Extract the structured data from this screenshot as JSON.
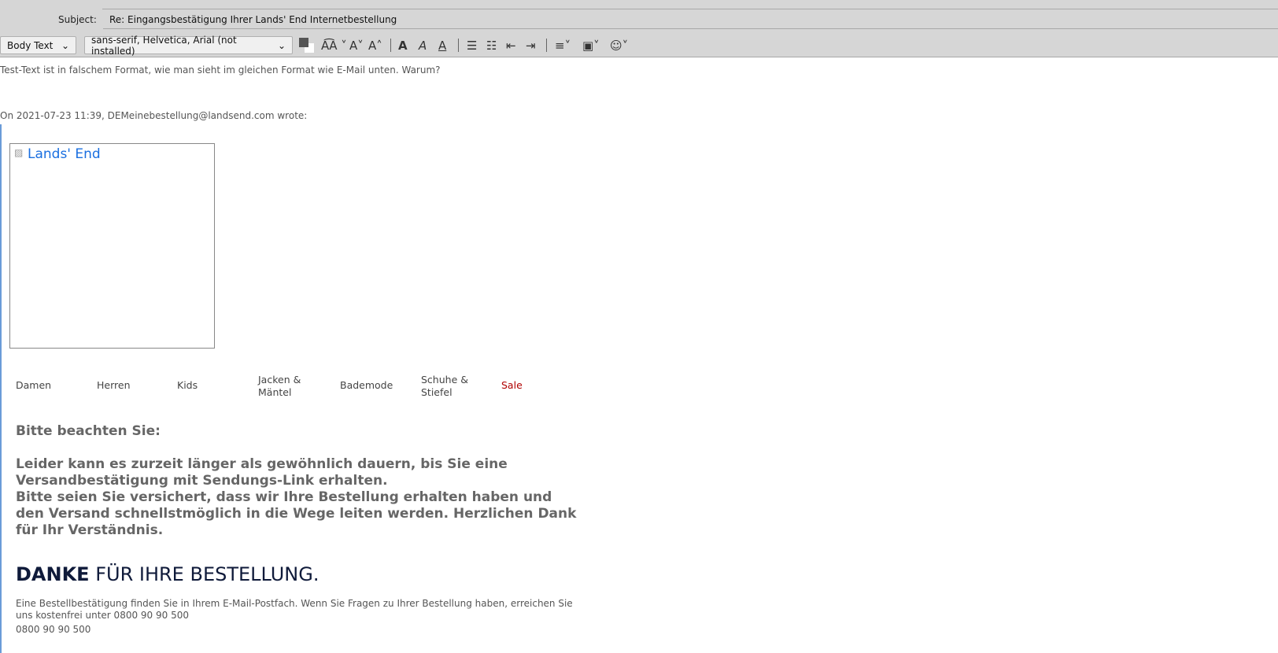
{
  "compose": {
    "subject_label": "Subject:",
    "subject_value": "Re: Eingangsbestätigung Ihrer Lands' End Internetbestellung"
  },
  "toolbar": {
    "paragraph_format": "Body Text",
    "font": "sans-serif, Helvetica, Arial (not installed)",
    "text_color": "#555555",
    "bg_color": "#ffffff"
  },
  "body": {
    "reply_text": "Test-Text ist in falschem Format, wie man sieht im gleichen Format wie E-Mail unten. Warum?",
    "attribution": "On 2021-07-23 11:39, DEMeinebestellung@landsend.com wrote:",
    "logo_alt": "Lands' End",
    "nav": [
      {
        "label": "Damen"
      },
      {
        "label": "Herren"
      },
      {
        "label": "Kids"
      },
      {
        "label": "Jacken & Mäntel"
      },
      {
        "label": "Bademode"
      },
      {
        "label": "Schuhe & Stiefel"
      },
      {
        "label": "Sale",
        "color": "#b00000"
      }
    ],
    "notice_title": "Bitte beachten Sie:",
    "notice_p1": "Leider kann es zurzeit länger als gewöhnlich dauern, bis Sie eine Versandbestätigung mit Sendungs-Link erhalten.",
    "notice_p2": "Bitte seien Sie versichert, dass wir Ihre Bestellung erhalten haben und den Versand schnellstmöglich in die Wege leiten werden. Herzlichen Dank für Ihr Verständnis.",
    "thanks_bold": "DANKE",
    "thanks_rest": " FÜR IHRE BESTELLUNG.",
    "info": "Eine Bestellbestätigung finden Sie in Ihrem E-Mail-Postfach. Wenn Sie Fragen zu Ihrer Bestellung haben, erreichen Sie uns kostenfrei unter 0800 90 90 500",
    "phone": "0800 90 90 500"
  }
}
